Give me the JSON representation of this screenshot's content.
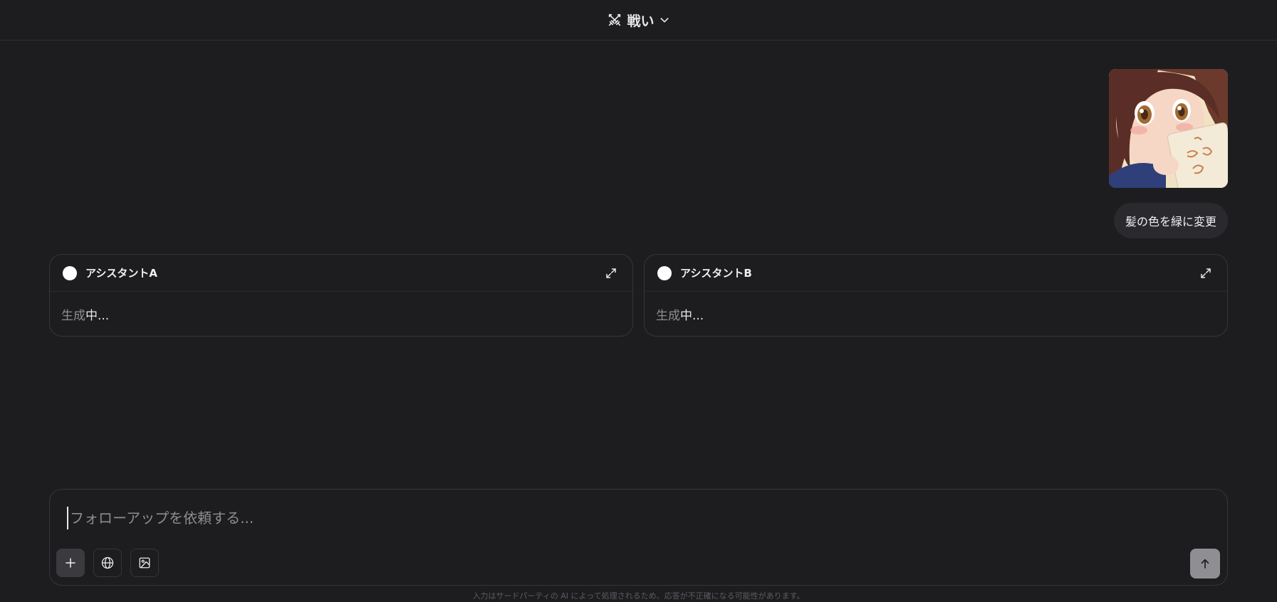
{
  "header": {
    "mode_label": "戦い"
  },
  "conversation": {
    "user_message": "髪の色を緑に変更",
    "image_text": "おはよう"
  },
  "assistants": [
    {
      "name": "アシスタントA",
      "status_dim": "生成",
      "status_bright": "中..."
    },
    {
      "name": "アシスタントB",
      "status_dim": "生成",
      "status_bright": "中..."
    }
  ],
  "composer": {
    "placeholder": "フォローアップを依頼する..."
  },
  "footer": {
    "disclaimer": "入力はサードパーティの AI によって処理されるため、応答が不正確になる可能性があります。"
  },
  "colors": {
    "background": "#1d1d1f",
    "card_border": "#36363a",
    "send_button": "#8e8e93"
  }
}
